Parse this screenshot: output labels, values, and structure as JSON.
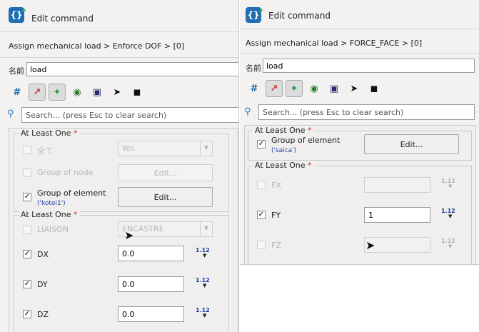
{
  "left": {
    "title": "Edit command",
    "breadcrumb": "Assign mechanical load > Enforce DOF > [0]",
    "name_label": "名前",
    "name_value": "load",
    "search_placeholder": "Search... (press Esc to clear search)",
    "group1": {
      "title": "At Least One",
      "rows": [
        {
          "label": "全て",
          "control": "Yes"
        },
        {
          "label": "Group of node",
          "control": "Edit..."
        },
        {
          "label": "Group of element",
          "sub": "('kotei1')",
          "control": "Edit..."
        }
      ]
    },
    "group2": {
      "title": "At Least One",
      "liaison_label": "LIAISON",
      "liaison_value": "ENCASTRE",
      "rows": [
        {
          "label": "DX",
          "value": "0.0",
          "ver": "1.12"
        },
        {
          "label": "DY",
          "value": "0.0",
          "ver": "1.12"
        },
        {
          "label": "DZ",
          "value": "0.0",
          "ver": "1.12"
        }
      ]
    }
  },
  "right": {
    "title": "Edit command",
    "breadcrumb": "Assign mechanical load > FORCE_FACE > [0]",
    "name_label": "名前",
    "name_value": "load",
    "search_placeholder": "Search... (press Esc to clear search)",
    "group1": {
      "title": "At Least One",
      "label": "Group of element",
      "sub": "('saica')",
      "control": "Edit..."
    },
    "group2": {
      "title": "At Least One",
      "rows": [
        {
          "label": "FX",
          "value": "",
          "ver": "1.12"
        },
        {
          "label": "FY",
          "value": "1",
          "ver": "1.12"
        },
        {
          "label": "FZ",
          "value": "",
          "ver": "1.12"
        }
      ]
    }
  },
  "required_mark": "*",
  "check_mark": "✓",
  "colors": {
    "accent": "#1f6fb2",
    "required": "#e03030",
    "sub_label": "#1a3fa6"
  }
}
